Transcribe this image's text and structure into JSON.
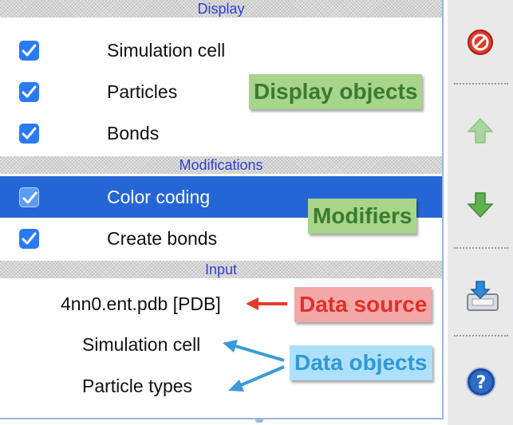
{
  "sections": {
    "display": "Display",
    "modifications": "Modifications",
    "input": "Input"
  },
  "display_items": [
    {
      "label": "Simulation cell",
      "checked": true
    },
    {
      "label": "Particles",
      "checked": true
    },
    {
      "label": "Bonds",
      "checked": true
    }
  ],
  "modifier_items": [
    {
      "label": "Color coding",
      "checked": true,
      "selected": true
    },
    {
      "label": "Create bonds",
      "checked": true,
      "selected": false
    }
  ],
  "input_items": {
    "source": "4nn0.ent.pdb [PDB]",
    "objects": [
      "Simulation cell",
      "Particle types"
    ]
  },
  "annotations": {
    "display_objects": "Display objects",
    "modifiers": "Modifiers",
    "data_source": "Data source",
    "data_objects": "Data objects"
  },
  "toolbar": {
    "icons": [
      "delete-icon",
      "move-up-icon",
      "move-down-icon",
      "save-icon",
      "help-icon"
    ]
  },
  "colors": {
    "selection": "#2566d6",
    "checkbox": "#2a7af4",
    "section_text": "#2f3fd8",
    "annotation_green": "#a7d58a",
    "annotation_red": "#f3a7a7",
    "annotation_blue": "#aee0fb"
  }
}
